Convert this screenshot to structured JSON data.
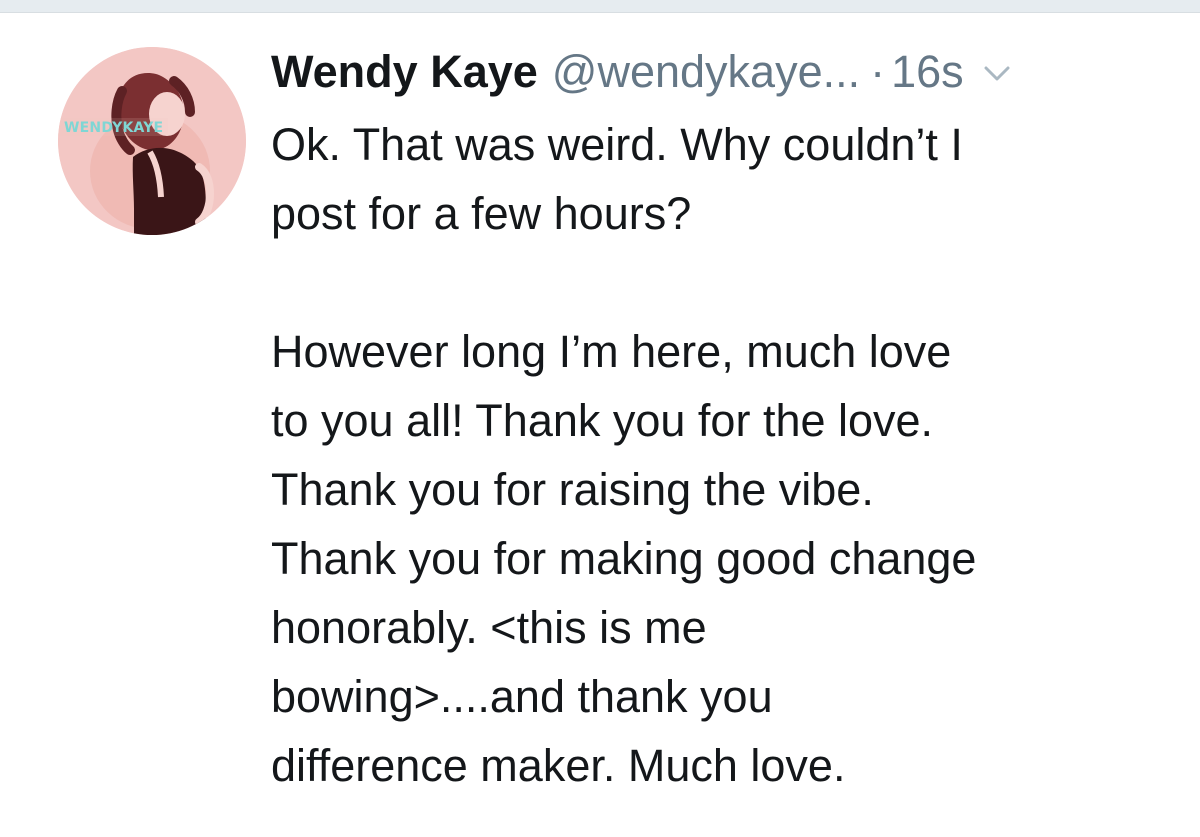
{
  "tweet": {
    "author": {
      "display_name": "Wendy Kaye",
      "handle": "@wendykaye..."
    },
    "separator": "·",
    "timestamp": "16s",
    "body": "Ok. That was weird. Why couldn’t I\npost for a few hours?\n\nHowever long I’m here, much love\nto you all! Thank you for the love.\nThank you for raising the vibe.\nThank you for making good change\nhonorably. <this is me\nbowing>....and thank you\ndifference maker. Much love."
  },
  "avatar": {
    "text": "WENDYKAYE"
  },
  "colors": {
    "primary_text": "#14171a",
    "secondary_text": "#657786",
    "avatar_background": "#f3c7c4",
    "avatar_accent": "#7fd6d4"
  },
  "icons": {
    "more": "chevron-down-icon"
  }
}
